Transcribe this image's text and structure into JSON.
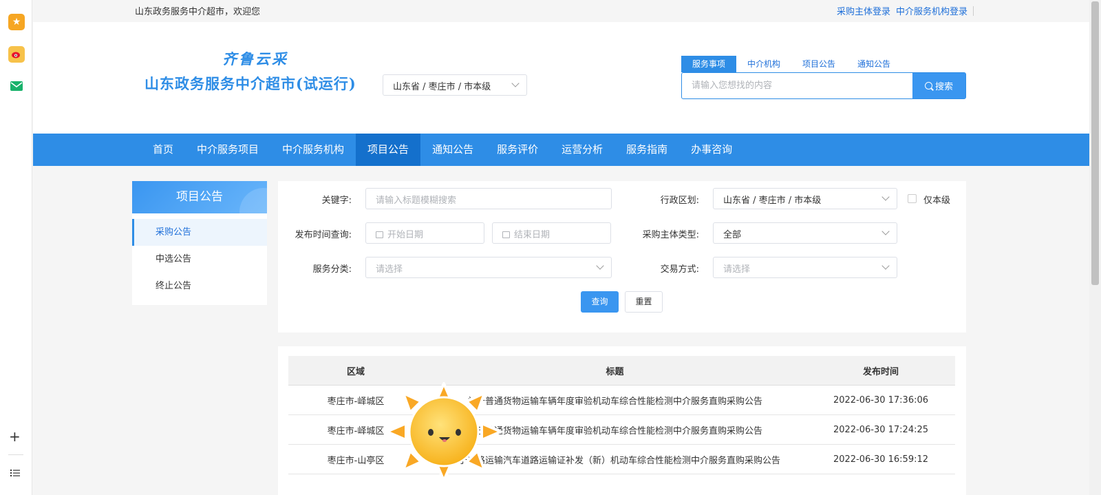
{
  "browser_sidebar": {
    "icons": [
      "star-icon",
      "weibo-icon",
      "mail-icon"
    ],
    "bottom": [
      "plus-icon",
      "list-icon"
    ]
  },
  "topbar": {
    "welcome": "山东政务服务中介超市，欢迎您",
    "login_buyer": "采购主体登录",
    "login_agency": "中介服务机构登录"
  },
  "header": {
    "logo_sub": "齐鲁云采",
    "logo_main": "山东政务服务中介超市(试运行)",
    "region": "山东省  / 枣庄市 / 市本级",
    "search_tabs": [
      "服务事项",
      "中介机构",
      "项目公告",
      "通知公告"
    ],
    "search_placeholder": "请输入您想找的内容",
    "search_button": "搜索"
  },
  "nav": {
    "items": [
      "首页",
      "中介服务项目",
      "中介服务机构",
      "项目公告",
      "通知公告",
      "服务评价",
      "运营分析",
      "服务指南",
      "办事咨询"
    ],
    "active": "项目公告"
  },
  "sidebar": {
    "title": "项目公告",
    "items": [
      "采购公告",
      "中选公告",
      "终止公告"
    ]
  },
  "filter": {
    "keyword_label": "关键字:",
    "keyword_placeholder": "请输入标题模糊搜索",
    "region_label": "行政区划:",
    "region_value": "山东省  / 枣庄市 / 市本级",
    "only_level": "仅本级",
    "date_label": "发布时间查询:",
    "start_placeholder": "开始日期",
    "end_placeholder": "结束日期",
    "buyer_type_label": "采购主体类型:",
    "buyer_type_value": "全部",
    "category_label": "服务分类:",
    "category_placeholder": "请选择",
    "trade_label": "交易方式:",
    "trade_placeholder": "请选择",
    "query_button": "查询",
    "reset_button": "重置"
  },
  "table": {
    "headers": [
      "区域",
      "标题",
      "发布时间"
    ],
    "rows": [
      {
        "region": "枣庄市-峄城区",
        "title": "关于普通货物运输车辆年度审验机动车综合性能检测中介服务直购采购公告",
        "time": "2022-06-30 17:36:06"
      },
      {
        "region": "枣庄市-峄城区",
        "title": "关于普通货物运输车辆年度审验机动车综合性能检测中介服务直购采购公告",
        "time": "2022-06-30 17:24:25"
      },
      {
        "region": "枣庄市-山亭区",
        "title": "关于道路运输汽车道路运输证补发（新）机动车综合性能检测中介服务直购采购公告",
        "time": "2022-06-30 16:59:12"
      }
    ]
  }
}
